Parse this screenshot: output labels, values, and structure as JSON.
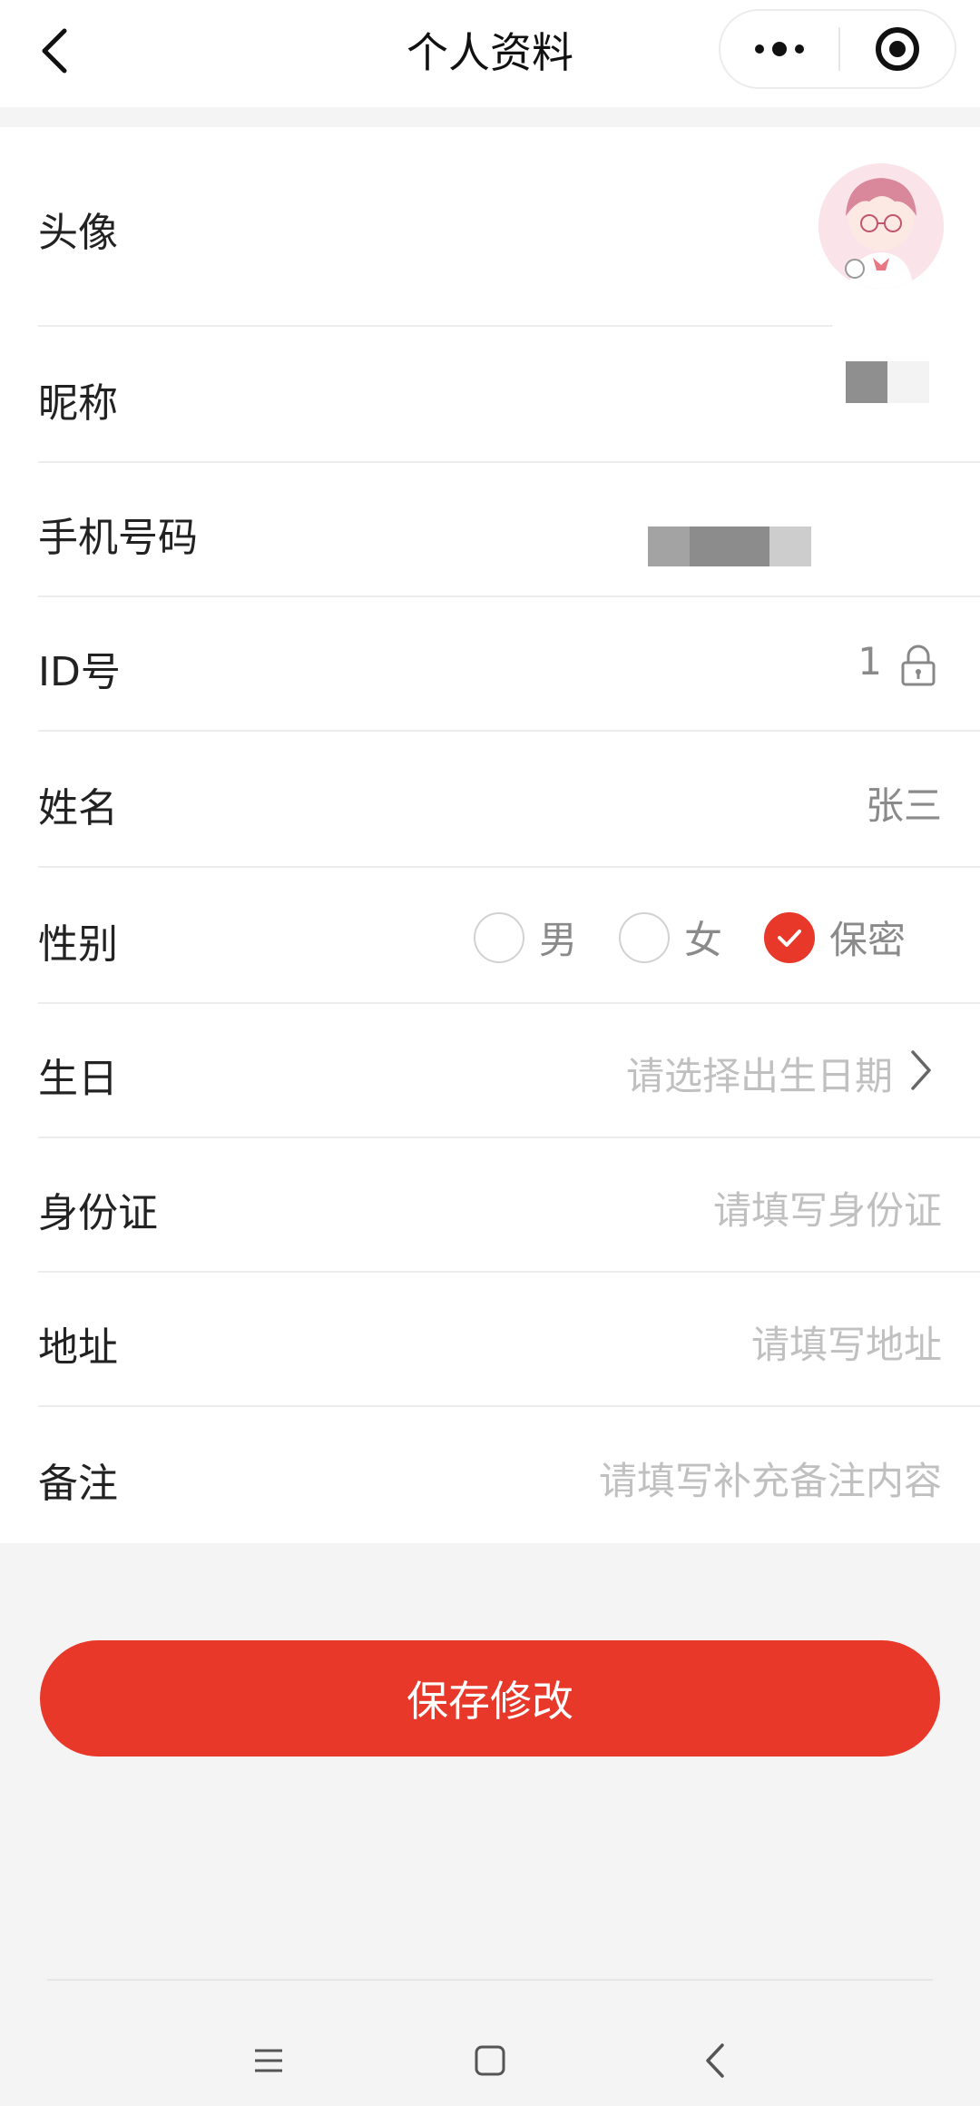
{
  "header": {
    "title": "个人资料",
    "back_icon": "chevron-left-icon",
    "more_icon": "more-dots-icon",
    "close_icon": "target-circle-icon"
  },
  "form": {
    "avatar_label": "头像",
    "nickname_label": "昵称",
    "phone_label": "手机号码",
    "id_label": "ID号",
    "id_value": "1",
    "name_label": "姓名",
    "name_value": "张三",
    "gender_label": "性别",
    "gender_options": [
      "男",
      "女",
      "保密"
    ],
    "gender_selected": "保密",
    "birthday_label": "生日",
    "birthday_placeholder": "请选择出生日期",
    "idcard_label": "身份证",
    "idcard_placeholder": "请填写身份证",
    "address_label": "地址",
    "address_placeholder": "请填写地址",
    "remark_label": "备注",
    "remark_placeholder": "请填写补充备注内容"
  },
  "save_button": "保存修改",
  "colors": {
    "accent": "#e8382a",
    "placeholder": "#c0c0c0",
    "value": "#8a8a8a",
    "background": "#f4f4f4"
  }
}
